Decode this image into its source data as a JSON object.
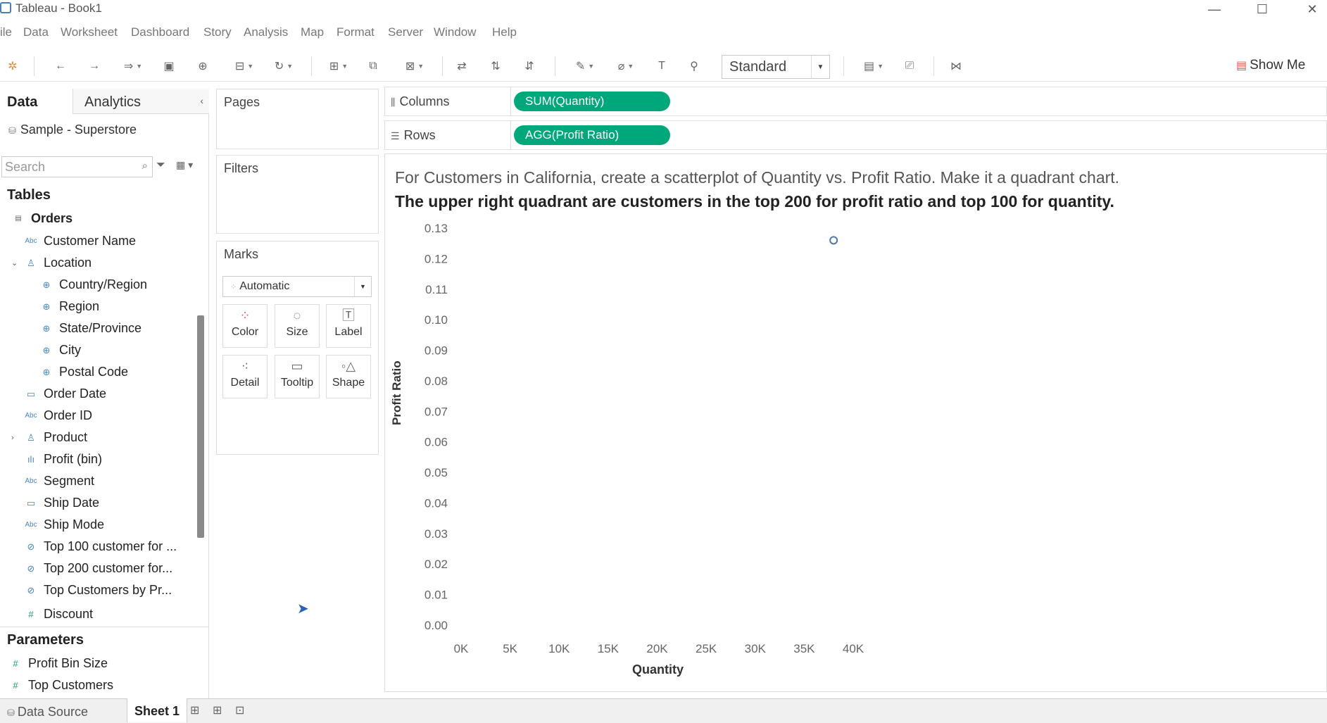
{
  "window": {
    "title": "Tableau - Book1",
    "minimize": "—",
    "maximize": "☐",
    "close": "✕"
  },
  "menu": [
    "ile",
    "Data",
    "Worksheet",
    "Dashboard",
    "Story",
    "Analysis",
    "Map",
    "Format",
    "Server",
    "Window",
    "Help"
  ],
  "toolbar": {
    "fit_mode": "Standard",
    "show_me": "Show Me"
  },
  "data_pane": {
    "tab_data": "Data",
    "tab_analytics": "Analytics",
    "datasource": "Sample - Superstore",
    "search_placeholder": "Search",
    "tables_header": "Tables",
    "orders": "Orders",
    "fields": [
      {
        "label": "Customer Name",
        "icon": "Abc"
      },
      {
        "label": "Location",
        "icon": "hierarchy"
      },
      {
        "label": "Country/Region",
        "icon": "globe"
      },
      {
        "label": "Region",
        "icon": "globe"
      },
      {
        "label": "State/Province",
        "icon": "globe"
      },
      {
        "label": "City",
        "icon": "globe"
      },
      {
        "label": "Postal Code",
        "icon": "globe"
      },
      {
        "label": "Order Date",
        "icon": "calendar"
      },
      {
        "label": "Order ID",
        "icon": "Abc"
      },
      {
        "label": "Product",
        "icon": "hierarchy"
      },
      {
        "label": "Profit (bin)",
        "icon": "bin"
      },
      {
        "label": "Segment",
        "icon": "Abc"
      },
      {
        "label": "Ship Date",
        "icon": "calendar"
      },
      {
        "label": "Ship Mode",
        "icon": "Abc"
      },
      {
        "label": "Top 100 customer for ...",
        "icon": "set"
      },
      {
        "label": "Top 200 customer for...",
        "icon": "set"
      },
      {
        "label": "Top Customers by Pr...",
        "icon": "set"
      },
      {
        "label": "Discount",
        "icon": "#"
      }
    ],
    "parameters_header": "Parameters",
    "parameters": [
      "Profit Bin Size",
      "Top Customers"
    ]
  },
  "cards": {
    "pages": "Pages",
    "filters": "Filters",
    "marks": "Marks",
    "mark_type": "Automatic",
    "mark_buttons": [
      "Color",
      "Size",
      "Label",
      "Detail",
      "Tooltip",
      "Shape"
    ]
  },
  "shelves": {
    "columns_label": "Columns",
    "columns_pill": "SUM(Quantity)",
    "rows_label": "Rows",
    "rows_pill": "AGG(Profit Ratio)"
  },
  "viz": {
    "title_line1": "For Customers in California, create a scatterplot of Quantity vs. Profit Ratio. Make it a quadrant chart.",
    "title_line2": "The upper right quadrant are customers in the top 200 for profit ratio and top 100 for quantity."
  },
  "chart_data": {
    "type": "scatter",
    "xlabel": "Quantity",
    "ylabel": "Profit Ratio",
    "x_ticks": [
      "0K",
      "5K",
      "10K",
      "15K",
      "20K",
      "25K",
      "30K",
      "35K",
      "40K"
    ],
    "y_ticks": [
      "0.00",
      "0.01",
      "0.02",
      "0.03",
      "0.04",
      "0.05",
      "0.06",
      "0.07",
      "0.08",
      "0.09",
      "0.10",
      "0.11",
      "0.12",
      "0.13"
    ],
    "xlim": [
      0,
      40000
    ],
    "ylim": [
      0,
      0.13
    ],
    "points": [
      {
        "x": 38000,
        "y": 0.126
      }
    ],
    "mark_color": "#4e79a7"
  },
  "bottom": {
    "data_source_tab": "Data Source",
    "sheet_tab": "Sheet 1"
  }
}
